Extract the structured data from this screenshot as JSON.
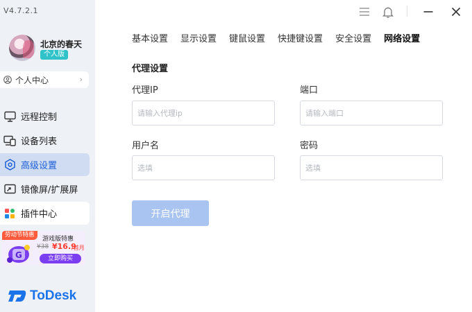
{
  "app": {
    "version": "V4.7.2.1",
    "brand_name": "ToDesk"
  },
  "user": {
    "name": "北京的春天",
    "plan_badge": "个人版"
  },
  "sidebar": {
    "profile_link": "个人中心",
    "items": [
      {
        "label": "远程控制",
        "icon": "monitor-icon"
      },
      {
        "label": "设备列表",
        "icon": "devices-icon"
      },
      {
        "label": "高级设置",
        "icon": "settings-hex-icon",
        "active": true
      },
      {
        "label": "镜像屏/扩展屏",
        "icon": "mirror-screen-icon"
      },
      {
        "label": "插件中心",
        "icon": "plugins-icon"
      }
    ]
  },
  "promo": {
    "tag": "劳动节特惠",
    "title": "游戏版特惠",
    "old_price": "¥38",
    "price": "¥16.9",
    "unit": "/首月",
    "button": "立即购买"
  },
  "window_controls": [
    "menu-icon",
    "bell-icon",
    "minimize-icon",
    "close-icon"
  ],
  "tabs": [
    "基本设置",
    "显示设置",
    "键鼠设置",
    "快捷键设置",
    "安全设置",
    "网络设置"
  ],
  "active_tab": "网络设置",
  "proxy": {
    "section_title": "代理设置",
    "ip_label": "代理IP",
    "ip_placeholder": "请输入代理ip",
    "port_label": "端口",
    "port_placeholder": "请输入端口",
    "user_label": "用户名",
    "user_placeholder": "选填",
    "password_label": "密码",
    "password_placeholder": "选填",
    "submit_label": "开启代理"
  },
  "colors": {
    "accent": "#1e5fd9",
    "active_nav_bg": "#cfdcf1",
    "disabled_button": "#a9c4f1",
    "sidebar_bg": "#eef1f6",
    "badge": "#2fc3c9"
  }
}
